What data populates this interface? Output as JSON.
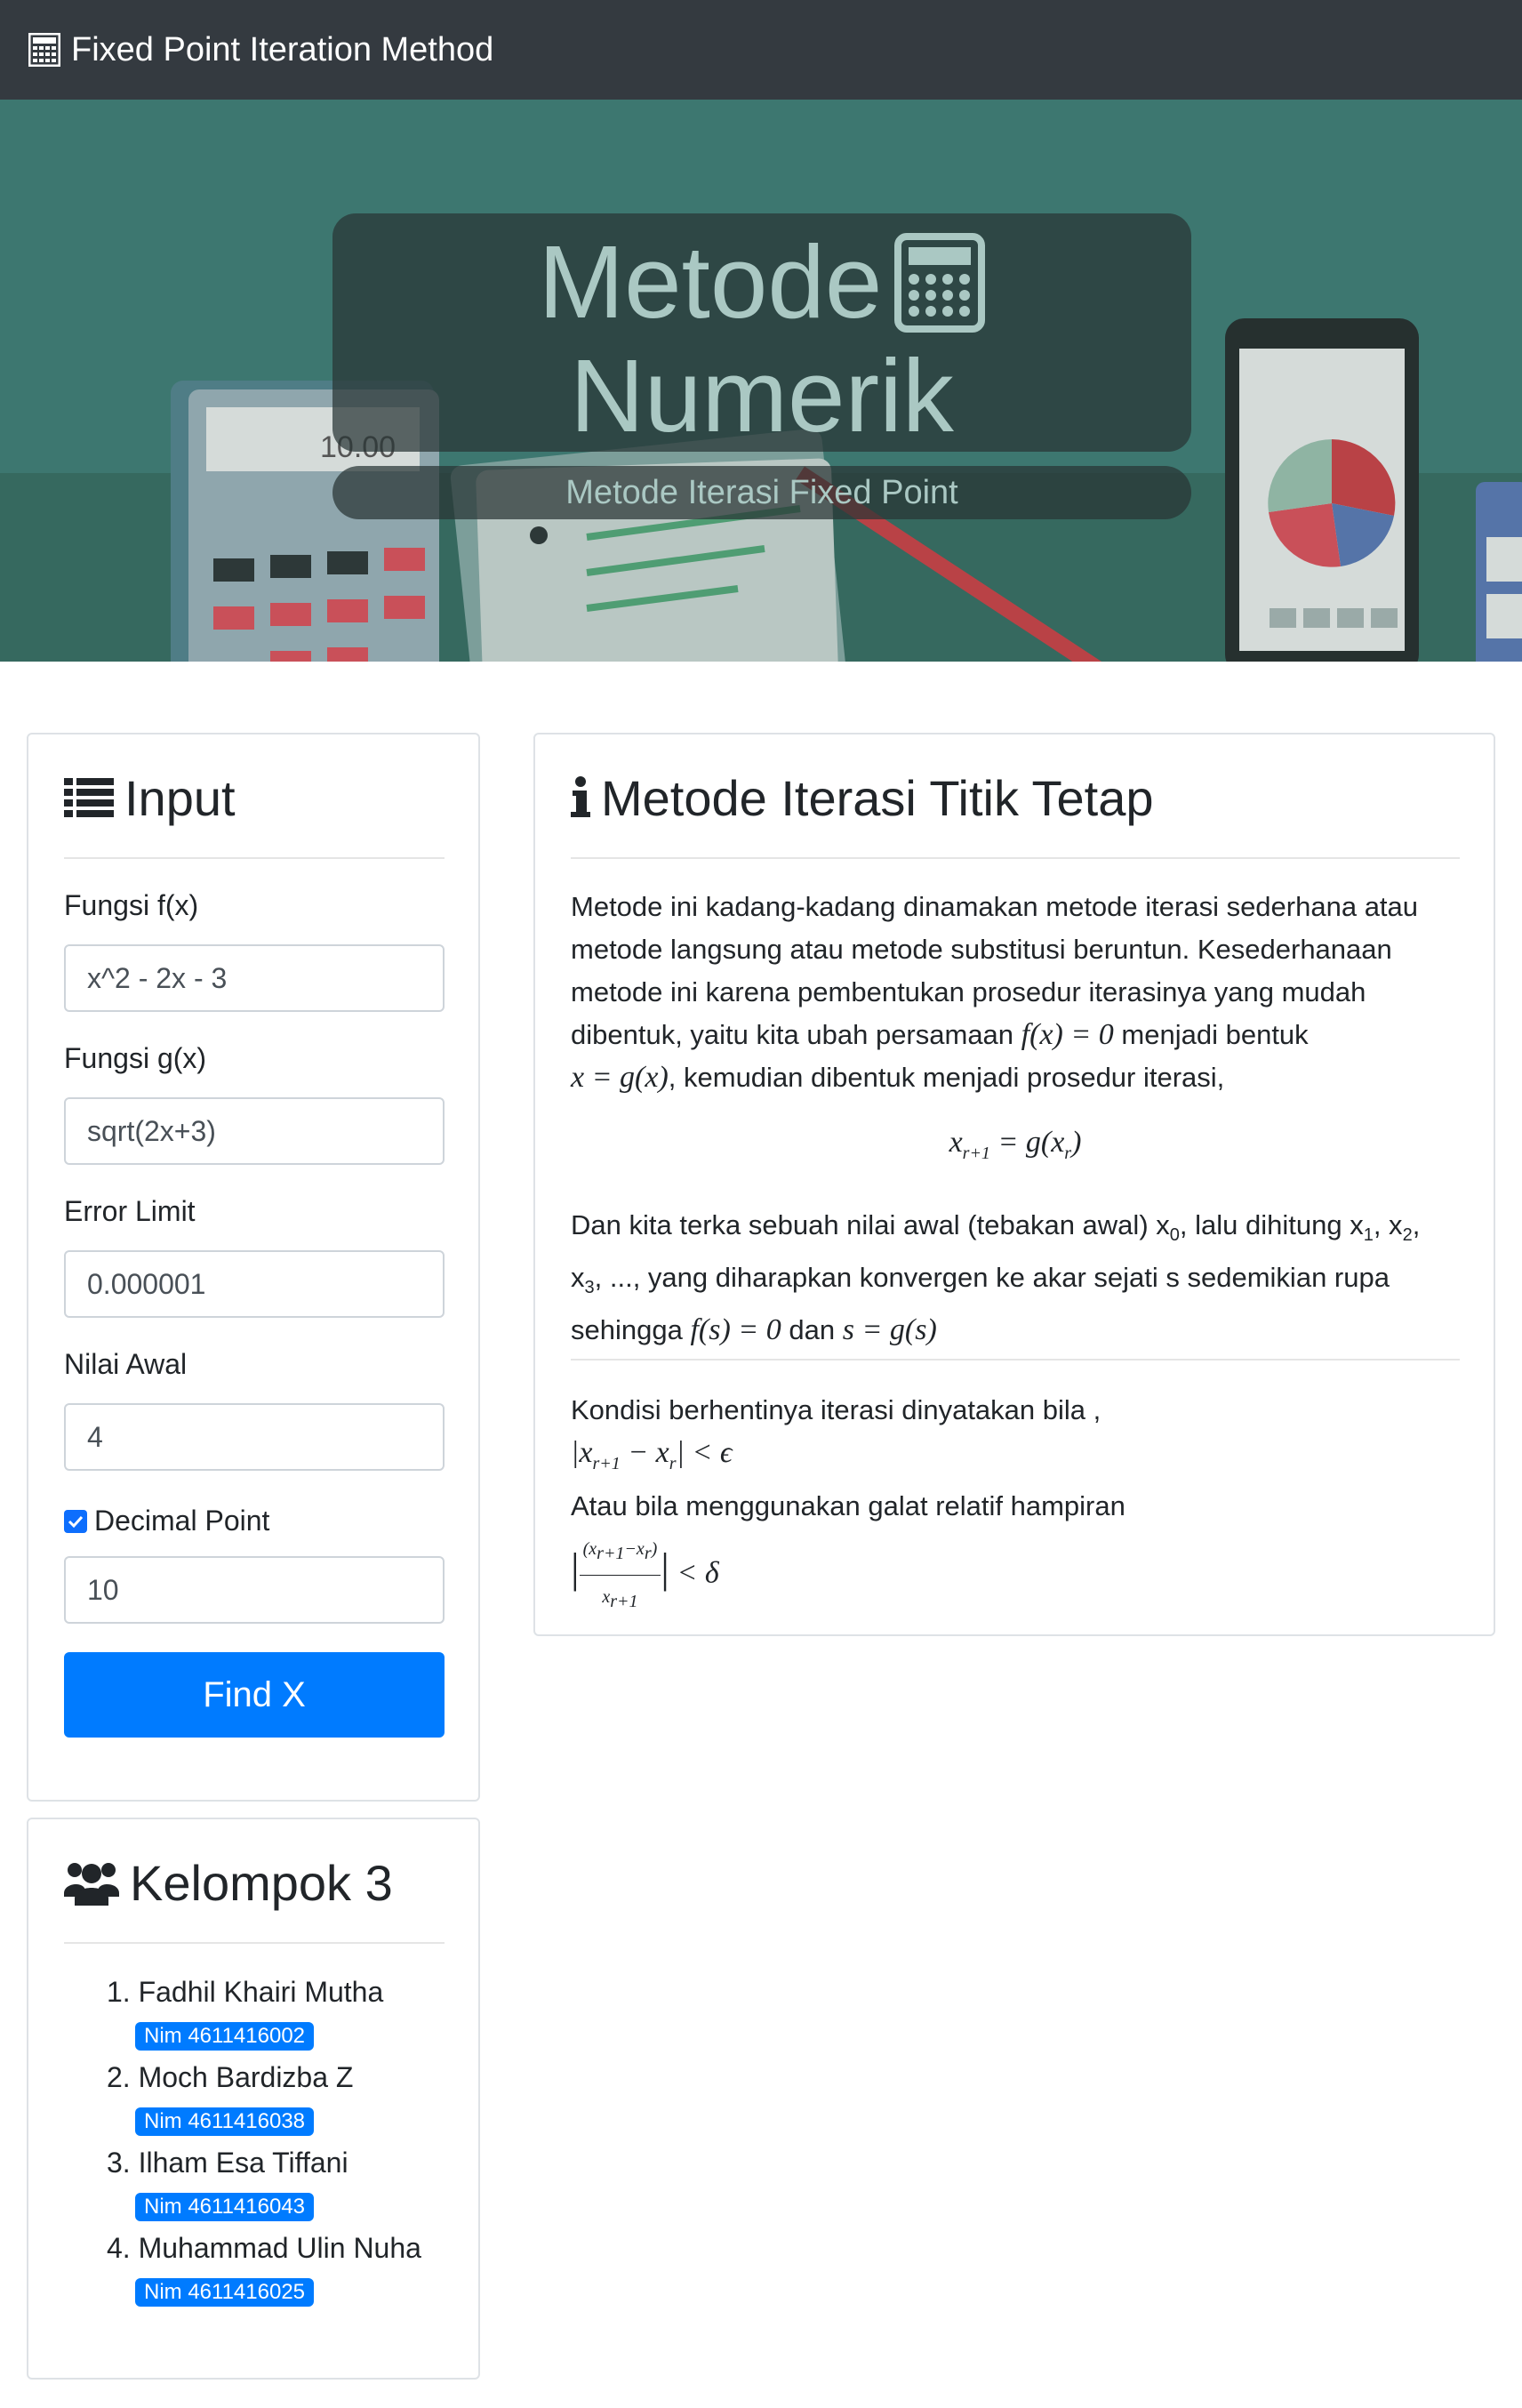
{
  "navbar": {
    "brand": "Fixed Point Iteration Method",
    "icon": "calculator-icon"
  },
  "hero": {
    "title_line1": "Metode",
    "title_line2": "Numerik",
    "subtitle": "Metode Iterasi Fixed Point",
    "illustration_display": "10.00"
  },
  "input_card": {
    "title": "Input",
    "fx_label": "Fungsi f(x)",
    "fx_value": "x^2 - 2x - 3",
    "gx_label": "Fungsi g(x)",
    "gx_value": "sqrt(2x+3)",
    "error_label": "Error Limit",
    "error_value": "0.000001",
    "initial_label": "Nilai Awal",
    "initial_value": "4",
    "decimal_label": "Decimal Point",
    "decimal_checked": true,
    "decimal_value": "10",
    "button": "Find X",
    "accent": "#007bff"
  },
  "info_card": {
    "title": "Metode Iterasi Titik Tetap",
    "p1_line1": "Metode ini kadang-kadang dinamakan metode iterasi sederhana atau",
    "p1_line2": "metode langsung atau metode substitusi beruntun. Kesederhanaan",
    "p1_line3": "metode ini karena pembentukan prosedur iterasinya yang mudah",
    "p1_line4_a": "dibentuk, yaitu kita ubah persamaan",
    "p1_line4_math": "f(x) = 0",
    "p1_line4_b": "menjadi bentuk",
    "p1_line5_math": "x = g(x)",
    "p1_line5_b": ", kemudian dibentuk menjadi prosedur iterasi,",
    "formula": "x(r+1) = g(x(r))",
    "p2_line1_a": "Dan kita terka sebuah nilai awal (tebakan awal) x",
    "p2_line1_b": ", lalu dihitung x",
    "p2_line2": ", ..., yang diharapkan konvergen ke akar sejati s sedemikian rupa",
    "p2_line3_a": "sehingga",
    "p2_line3_math1": "f(s) = 0",
    "p2_line3_b": "dan",
    "p2_line3_math2": "s = g(s)",
    "p3_line1": "Kondisi berhentinya iterasi dinyatakan bila ,",
    "p3_line3": "Atau bila menggunakan galat relatif hampiran"
  },
  "team_card": {
    "title": "Kelompok 3",
    "members": [
      {
        "name": "1. Fadhil Khairi Mutha",
        "nim": "Nim 4611416002"
      },
      {
        "name": "2. Moch Bardizba Z",
        "nim": "Nim 4611416038"
      },
      {
        "name": "3. Ilham Esa Tiffani",
        "nim": "Nim 4611416043"
      },
      {
        "name": "4. Muhammad Ulin Nuha",
        "nim": "Nim 4611416025"
      }
    ]
  }
}
